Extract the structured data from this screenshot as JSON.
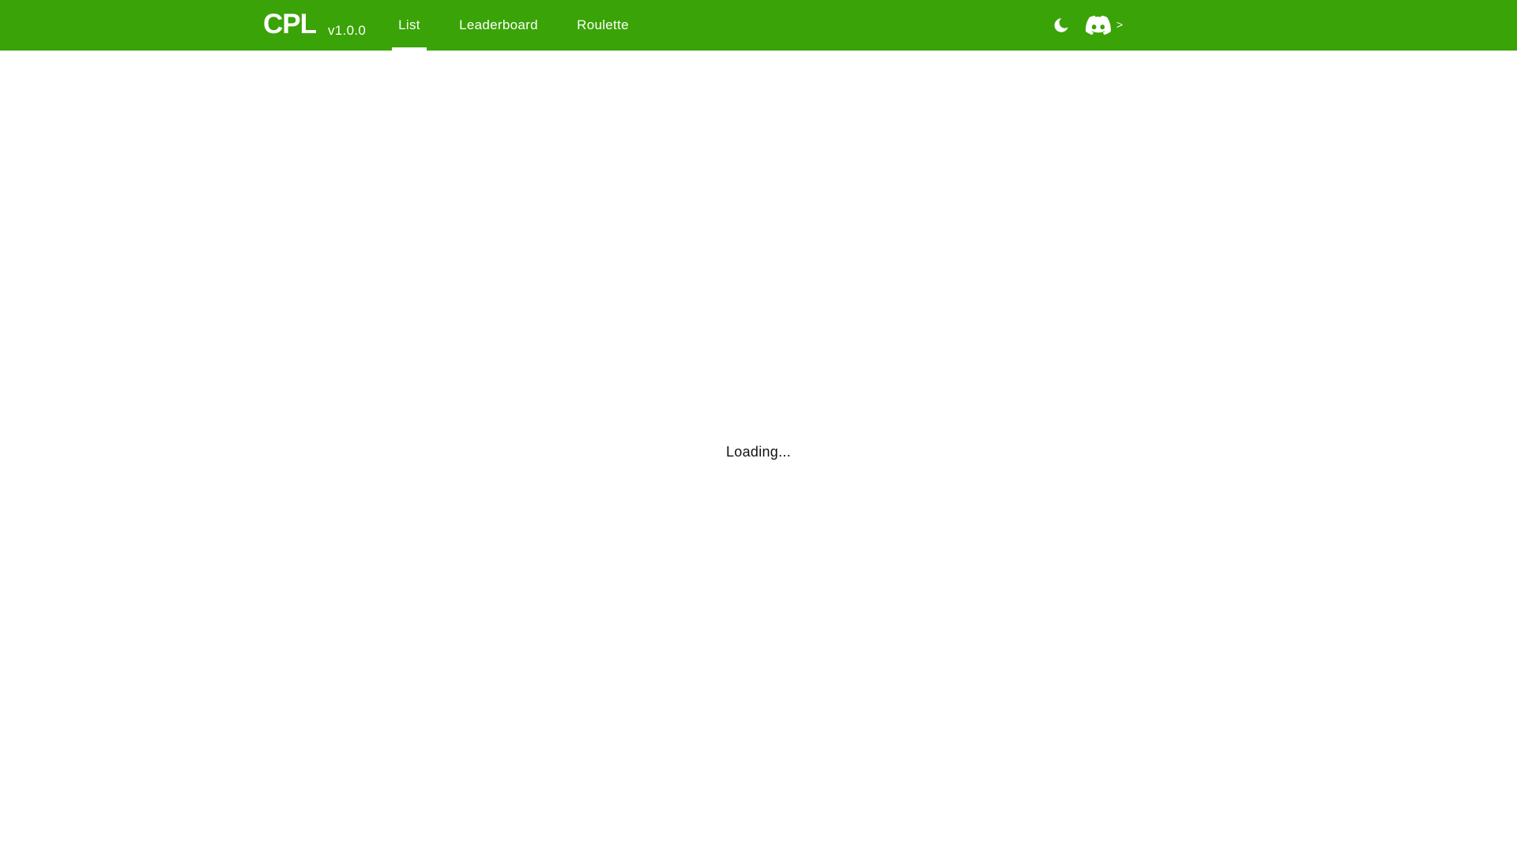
{
  "app": {
    "brand": "CPL",
    "version": "v1.0.0"
  },
  "nav": {
    "tabs": [
      {
        "label": "List",
        "active": true
      },
      {
        "label": "Leaderboard",
        "active": false
      },
      {
        "label": "Roulette",
        "active": false
      }
    ]
  },
  "header_actions": {
    "theme_icon": "moon-icon",
    "discord_icon": "discord-icon",
    "chevron_label": ">"
  },
  "main": {
    "status": "Loading..."
  },
  "colors": {
    "topbar": "#3aa307",
    "topbar_text": "#ffffff",
    "background": "#ffffff",
    "body_text": "#111111"
  }
}
